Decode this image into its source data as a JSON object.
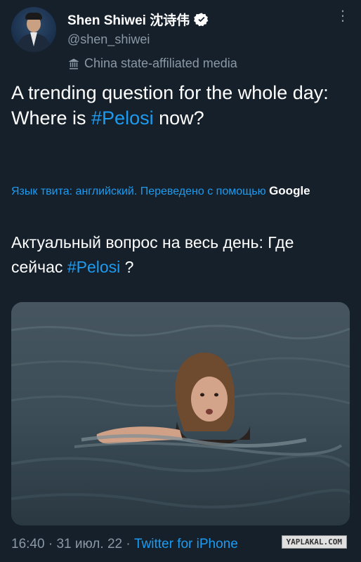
{
  "author": {
    "name": "Shen Shiwei 沈诗伟",
    "handle": "@shen_shiwei",
    "label": "China state-affiliated media",
    "verified_color": "#ffffff"
  },
  "tweet": {
    "text_before": "A trending question for the whole day: Where is ",
    "hashtag": "#Pelosi",
    "text_after": " now?"
  },
  "translation": {
    "note": "Язык твита: английский. Переведено с помощью",
    "service": "Google",
    "text_before": "Актуальный вопрос на весь день: Где сейчас ",
    "hashtag": "#Pelosi",
    "text_after": " ?"
  },
  "footer": {
    "time": "16:40",
    "date": "31 июл. 22",
    "separator": "·",
    "source": "Twitter for iPhone"
  },
  "watermark": "YAPLAKAL.COM",
  "colors": {
    "background": "#15202b",
    "link": "#1d9bf0",
    "muted": "#8b98a5"
  }
}
